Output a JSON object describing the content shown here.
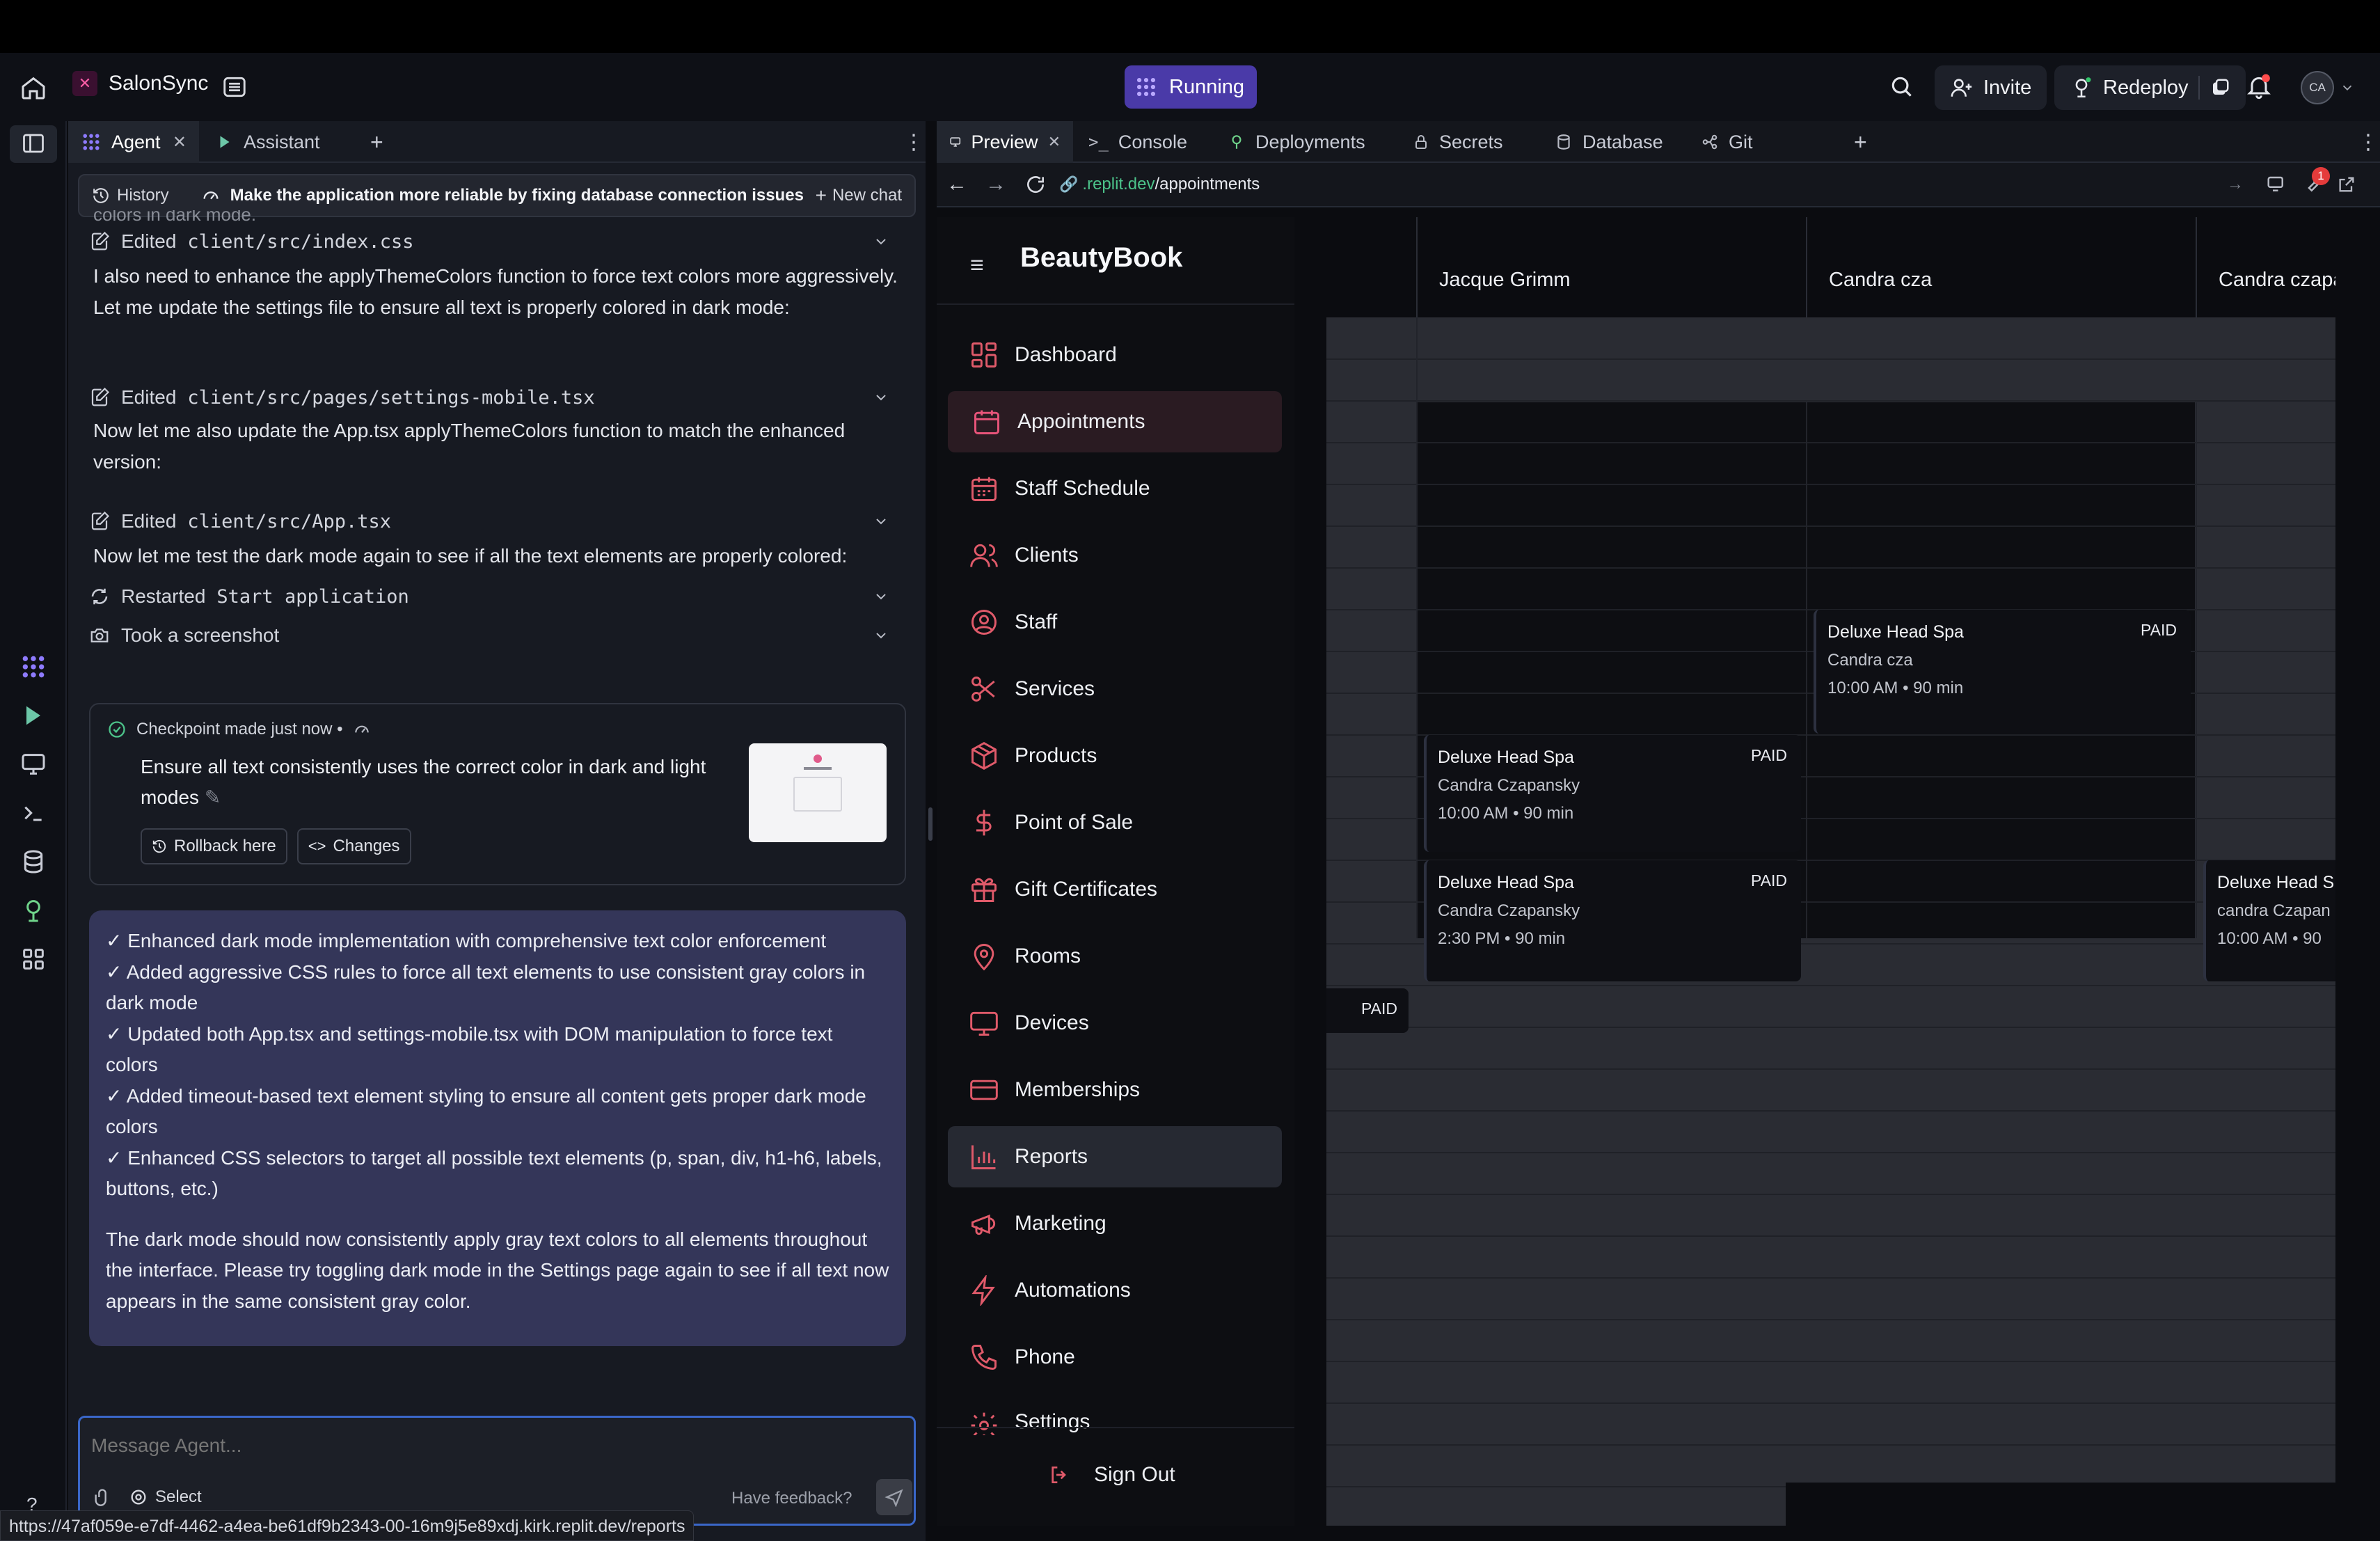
{
  "app": {
    "name": "SalonSync",
    "status": "Running",
    "invite_label": "Invite",
    "redeploy_label": "Redeploy",
    "avatar_initials": "CA"
  },
  "agent_panel": {
    "tabs": [
      {
        "label": "Agent",
        "active": true
      },
      {
        "label": "Assistant",
        "active": false
      }
    ],
    "history_label": "History",
    "chat_title": "Make the application more reliable by fixing database connection issues",
    "new_chat_label": "New chat",
    "cut_line": "colors in dark mode.",
    "feed": [
      {
        "type": "action",
        "verb": "Edited",
        "target": "client/src/index.css"
      },
      {
        "type": "text",
        "text": "I also need to enhance the applyThemeColors function to force text colors more aggressively. Let me update the settings file to ensure all text is properly colored in dark mode:"
      },
      {
        "type": "action",
        "verb": "Edited",
        "target": "client/src/pages/settings-mobile.tsx"
      },
      {
        "type": "text",
        "text": "Now let me also update the App.tsx applyThemeColors function to match the enhanced version:"
      },
      {
        "type": "action",
        "verb": "Edited",
        "target": "client/src/App.tsx"
      },
      {
        "type": "text",
        "text": "Now let me test the dark mode again to see if all the text elements are properly colored:"
      },
      {
        "type": "action",
        "verb": "Restarted",
        "target": "Start application"
      },
      {
        "type": "action",
        "verb": "Took a screenshot",
        "target": ""
      }
    ],
    "checkpoint": {
      "header": "Checkpoint made just now •",
      "description": "Ensure all text consistently uses the correct color in dark and light modes",
      "rollback_label": "Rollback here",
      "changes_label": "Changes"
    },
    "summary": {
      "bullets": [
        "✓ Enhanced dark mode implementation with comprehensive text color enforcement",
        "✓ Added aggressive CSS rules to force all text elements to use consistent gray colors in dark mode",
        "✓ Updated both App.tsx and settings-mobile.tsx with DOM manipulation to force text colors",
        "✓ Added timeout-based text element styling to ensure all content gets proper dark mode colors",
        "✓ Enhanced CSS selectors to target all possible text elements (p, span, div, h1-h6, labels, buttons, etc.)"
      ],
      "closing": "The dark mode should now consistently apply gray text colors to all elements throughout the interface. Please try toggling dark mode in the Settings page again to see if all text now appears in the same consistent gray color."
    },
    "composer": {
      "placeholder": "Message Agent...",
      "select_label": "Select",
      "feedback_label": "Have feedback?"
    }
  },
  "status_url": "https://47af059e-e7df-4462-a4ea-be61df9b2343-00-16m9j5e89xdj.kirk.replit.dev/reports",
  "preview_panel": {
    "tabs": [
      "Preview",
      "Console",
      "Deployments",
      "Secrets",
      "Database",
      "Git"
    ],
    "url_host": ".replit.dev",
    "url_path": "/appointments",
    "notification_count": "1"
  },
  "beautybook": {
    "brand": "BeautyBook",
    "nav": [
      {
        "label": "Dashboard",
        "icon": "dashboard-icon"
      },
      {
        "label": "Appointments",
        "icon": "calendar-icon"
      },
      {
        "label": "Staff Schedule",
        "icon": "calendar-grid-icon"
      },
      {
        "label": "Clients",
        "icon": "users-icon"
      },
      {
        "label": "Staff",
        "icon": "user-circle-icon"
      },
      {
        "label": "Services",
        "icon": "scissors-icon"
      },
      {
        "label": "Products",
        "icon": "package-icon"
      },
      {
        "label": "Point of Sale",
        "icon": "dollar-icon"
      },
      {
        "label": "Gift Certificates",
        "icon": "gift-icon"
      },
      {
        "label": "Rooms",
        "icon": "map-pin-icon"
      },
      {
        "label": "Devices",
        "icon": "monitor-icon"
      },
      {
        "label": "Memberships",
        "icon": "credit-card-icon"
      },
      {
        "label": "Reports",
        "icon": "bar-chart-icon"
      },
      {
        "label": "Marketing",
        "icon": "megaphone-icon"
      },
      {
        "label": "Automations",
        "icon": "zap-icon"
      },
      {
        "label": "Phone",
        "icon": "phone-icon"
      },
      {
        "label": "Settings",
        "icon": "settings-icon"
      }
    ],
    "sign_out_label": "Sign Out",
    "staff_columns": [
      "Jacque Grimm",
      "Candra cza",
      "Candra czapa"
    ],
    "appointments": [
      {
        "service": "Deluxe Head Spa",
        "client": "Candra cza",
        "time": "10:00 AM • 90 min",
        "status": "PAID"
      },
      {
        "service": "Deluxe Head Spa",
        "client": "Candra Czapansky",
        "time": "10:00 AM • 90 min",
        "status": "PAID"
      },
      {
        "service": "Deluxe Head Spa",
        "client": "Candra Czapansky",
        "time": "2:30 PM • 90 min",
        "status": "PAID"
      },
      {
        "service": "Deluxe Head S",
        "client": "candra Czapan",
        "time": "10:00 AM • 90",
        "status": ""
      }
    ],
    "orphan_paid": "PAID"
  }
}
